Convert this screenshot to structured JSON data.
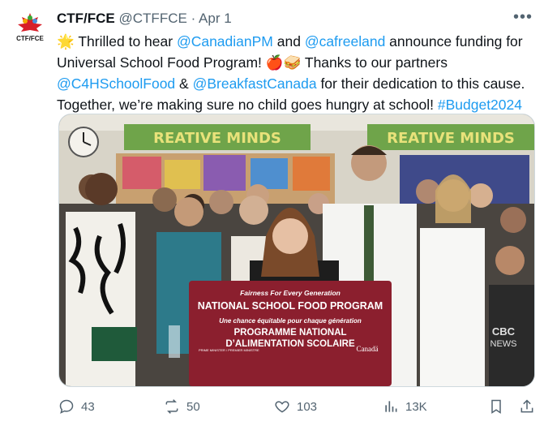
{
  "author": {
    "name": "CTF/FCE",
    "handle": "@CTFFCE",
    "separator": "·",
    "date": "Apr 1",
    "logo_text": "CTF/FCE"
  },
  "tweet": {
    "star": "🌟",
    "part1": " Thrilled to hear ",
    "mention1": "@CanadianPM",
    "part2": " and ",
    "mention2": "@cafreeland",
    "part3": " announce funding for Universal School Food Program! ",
    "emoji": "🍎🥪",
    "part4": " Thanks to our partners ",
    "mention3": "@C4HSchoolFood",
    "part5": " & ",
    "mention4": "@BreakfastCanada",
    "part6": " for their dedication to this cause. Together, we’re making sure no child goes hungry at school! ",
    "hashtag": "#Budget2024"
  },
  "media": {
    "banner_left": "REATIVE MINDS",
    "banner_right": "REATIVE MINDS",
    "podium_line1": "Fairness For Every Generation",
    "podium_line2": "NATIONAL SCHOOL FOOD PROGRAM",
    "podium_line3": "Une chance équitable pour chaque génération",
    "podium_line4": "PROGRAMME NATIONAL",
    "podium_line5": "D’ALIMENTATION SCOLAIRE",
    "podium_small": "PRIME MINISTER / PREMIER MINISTRE",
    "podium_canada": "Canadä",
    "watermark1": "CBC",
    "watermark2": "NEWS"
  },
  "actions": {
    "replies": "43",
    "retweets": "50",
    "likes": "103",
    "views": "13K"
  },
  "colors": {
    "link": "#1d9bf0",
    "muted": "#536471",
    "podium": "#8b1f2e"
  }
}
